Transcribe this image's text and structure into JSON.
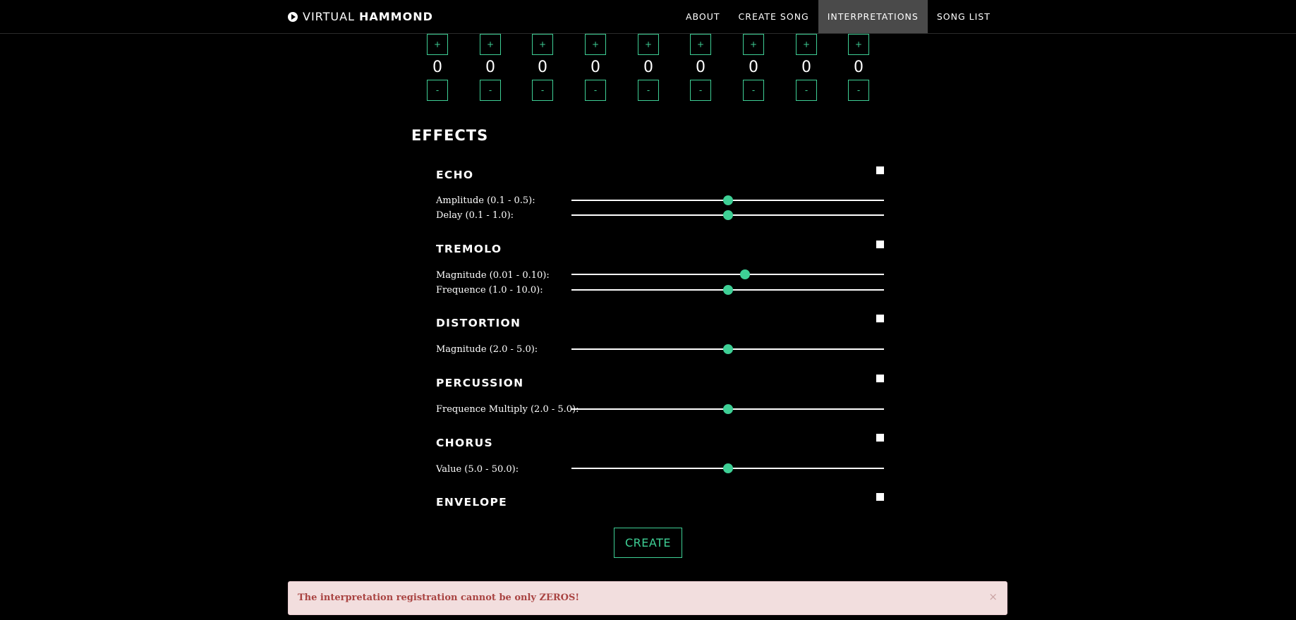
{
  "nav": {
    "brand_light": "VIRTUAL",
    "brand_bold": "HAMMOND",
    "items": [
      "ABOUT",
      "CREATE SONG",
      "INTERPRETATIONS",
      "SONG LIST"
    ],
    "active": "INTERPRETATIONS"
  },
  "drawbars": {
    "plus_label": "+",
    "minus_label": "-",
    "values": [
      "0",
      "0",
      "0",
      "0",
      "0",
      "0",
      "0",
      "0",
      "0"
    ]
  },
  "effects": {
    "title": "EFFECTS",
    "echo": {
      "name": "ECHO",
      "amplitude_label": "Amplitude (0.1 - 0.5):",
      "amplitude_level": 0.5,
      "delay_label": "Delay (0.1 - 1.0):",
      "delay_level": 0.5
    },
    "tremolo": {
      "name": "TREMOLO",
      "magnitude_label": "Magnitude (0.01 - 0.10):",
      "magnitude_level": 0.555,
      "frequence_label": "Frequence (1.0 - 10.0):",
      "frequence_level": 0.5
    },
    "distortion": {
      "name": "DISTORTION",
      "magnitude_label": "Magnitude (2.0 - 5.0):",
      "magnitude_level": 0.5
    },
    "percussion": {
      "name": "PERCUSSION",
      "multiply_label": "Frequence Multiply (2.0 - 5.0):",
      "multiply_level": 0.5
    },
    "chorus": {
      "name": "CHORUS",
      "value_label": "Value (5.0 - 50.0):",
      "value_level": 0.5
    },
    "envelope": {
      "name": "ENVELOPE"
    }
  },
  "create_label": "CREATE",
  "alert": {
    "message": "The interpretation registration cannot be only ZEROS!",
    "close": "×"
  },
  "colors": {
    "accent": "#3ecf95",
    "alert_bg": "#f2dede",
    "alert_text": "#a94442",
    "nav_active": "#4a4a4a"
  }
}
